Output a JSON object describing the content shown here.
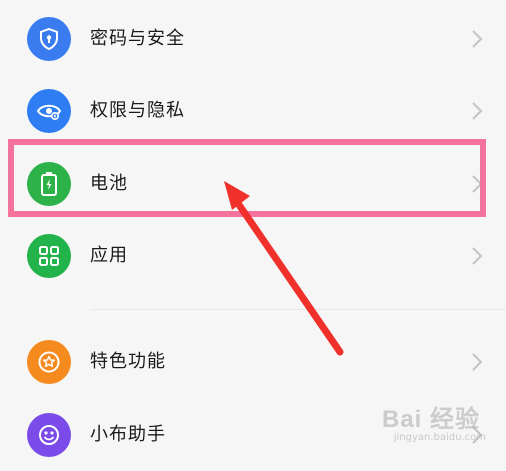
{
  "settings_list": {
    "items": [
      {
        "label": "密码与安全",
        "icon": "shield-lock-icon",
        "color": "#3a7cf0"
      },
      {
        "label": "权限与隐私",
        "icon": "eye-privacy-icon",
        "color": "#2f7df2"
      },
      {
        "label": "电池",
        "icon": "battery-icon",
        "color": "#2db24a"
      },
      {
        "label": "应用",
        "icon": "apps-grid-icon",
        "color": "#22b44a"
      },
      {
        "label": "特色功能",
        "icon": "star-badge-icon",
        "color": "#f58a1f"
      },
      {
        "label": "小布助手",
        "icon": "assistant-icon",
        "color": "#7a4be8"
      }
    ]
  },
  "annotation": {
    "highlight_color": "#f4739d",
    "arrow_color": "#f0302a"
  },
  "watermark": {
    "text": "Bai 经验",
    "sub": "jingyan.baidu.com"
  }
}
